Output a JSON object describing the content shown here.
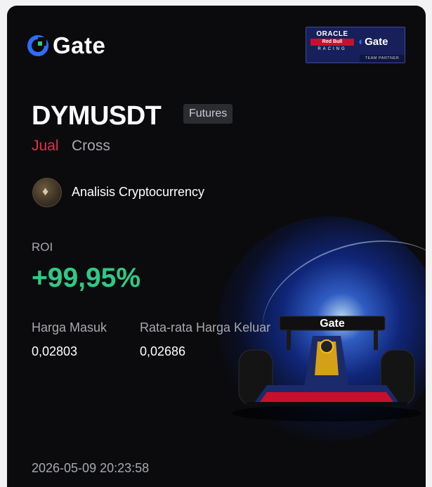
{
  "brand": {
    "name": "Gate",
    "accent": "#2f6bff"
  },
  "partner": {
    "oracle": "ORACLE",
    "redbull": "Red Bull",
    "racing": "RACING",
    "gate": "Gate",
    "tagline": "TEAM PARTNER"
  },
  "trade": {
    "pair": "DYMUSDT",
    "market_badge": "Futures",
    "side": "Jual",
    "margin_mode": "Cross",
    "analysis_label": "Analisis Cryptocurrency",
    "roi_label": "ROI",
    "roi_value": "+99,95%",
    "entry_label": "Harga Masuk",
    "entry_value": "0,02803",
    "exit_label": "Rata-rata Harga Keluar",
    "exit_value": "0,02686",
    "timestamp": "2026-05-09 20:23:58"
  },
  "colors": {
    "sell": "#e2324a",
    "profit": "#2fc984",
    "muted": "#a7a9ae"
  },
  "car": {
    "wing_text": "Gate"
  }
}
